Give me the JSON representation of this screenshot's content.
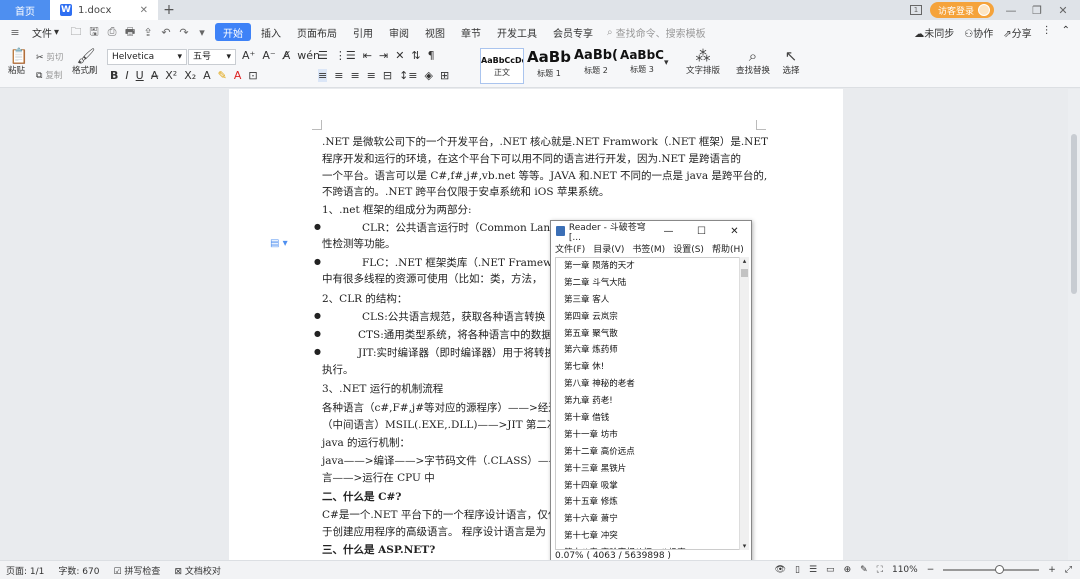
{
  "tabs": {
    "home": "首页",
    "doc": "1.docx"
  },
  "title_right": {
    "visitor": "访客登录"
  },
  "menu": {
    "file": "文件",
    "items": [
      "开始",
      "插入",
      "页面布局",
      "引用",
      "审阅",
      "视图",
      "章节",
      "开发工具",
      "会员专享"
    ],
    "search": "查找命令、搜索模板",
    "right": [
      "未同步",
      "协作",
      "分享"
    ]
  },
  "ribbon": {
    "paste": "粘贴",
    "cut": "剪切",
    "copy": "复制",
    "format_painter": "格式刷",
    "font_name": "Helvetica",
    "font_size": "五号",
    "styles": [
      {
        "sample": "AaBbCcDd",
        "name": "正文"
      },
      {
        "sample": "AaBb",
        "name": "标题 1"
      },
      {
        "sample": "AaBb(",
        "name": "标题 2"
      },
      {
        "sample": "AaBbC",
        "name": "标题 3"
      }
    ],
    "text_layout": "文字排版",
    "find_replace": "查找替换",
    "select": "选择"
  },
  "document": {
    "lines": [
      ".NET 是微软公司下的一个开发平台，.NET 核心就是.NET Framwork（.NET 框架）是.NET",
      "程序开发和运行的环境，在这个平台下可以用不同的语言进行开发，因为.NET 是跨语言的",
      "一个平台。语言可以是 C#,f#,j#,vb.net 等等。JAVA 和.NET 不同的一点是 java 是跨平台的,",
      "不跨语言的。.NET 跨平台仅限于安卓系统和  iOS  苹果系统。",
      "1、.net 框架的组成分为两部分:",
      "CLR：公共语言运行时（Common Lang",
      "性检测等功能。",
      "FLC：.NET 框架类库（.NET Framework",
      "中有很多线程的资源可使用（比如：类，方法，",
      "2、CLR 的结构：",
      "CLS:公共语言规范，获取各种语言转换",
      "CTS:通用类型系统，将各种语言中的数据",
      "JIT:实时编译器（即时编译器）用于将转换",
      "执行。",
      "3、.NET 运行的机制流程",
      "各种语言（c#,F#,j#等对应的源程序）——>经过",
      "（中间语言）MSIL(.EXE,.DLL)——>JIT 第二次编",
      "java 的运行机制：",
      "java——>编译——>字节码文件（.CLASS）——",
      "言——>运行在 CPU 中",
      "二、什么是 C#?",
      "C#是一个.NET 平台下的一个程序设计语言，仅仅",
      "于创建应用程序的高级语言。  程序设计语言是为",
      "三、什么是 ASP.NET?"
    ]
  },
  "reader": {
    "title": "Reader - 斗破苍穹[...",
    "menu": [
      "文件(F)",
      "目录(V)",
      "书签(M)",
      "设置(S)",
      "帮助(H)"
    ],
    "chapters": [
      "第一章 陨落的天才",
      "第二章 斗气大陆",
      "第三章 客人",
      "第四章 云岚宗",
      "第五章 聚气散",
      "第六章 炼药师",
      "第七章 休!",
      "第八章 神秘的老者",
      "第九章 药老!",
      "第十章 借钱",
      "第十一章 坊市",
      "第十二章 高价远点",
      "第十三章 黑铁片",
      "第十四章 吸掌",
      "第十五章 修炼",
      "第十六章 萧宁",
      "第十七章 冲突",
      "第十八章 实验室相斗打，八极察"
    ],
    "status": "0.07%  ( 4063 / 5639898 )"
  },
  "status": {
    "page": "页面: 1/1",
    "words": "字数: 670",
    "spell": "拼写检查",
    "proof": "文档校对",
    "zoom": "110%",
    "zoom_level": 0.58
  }
}
